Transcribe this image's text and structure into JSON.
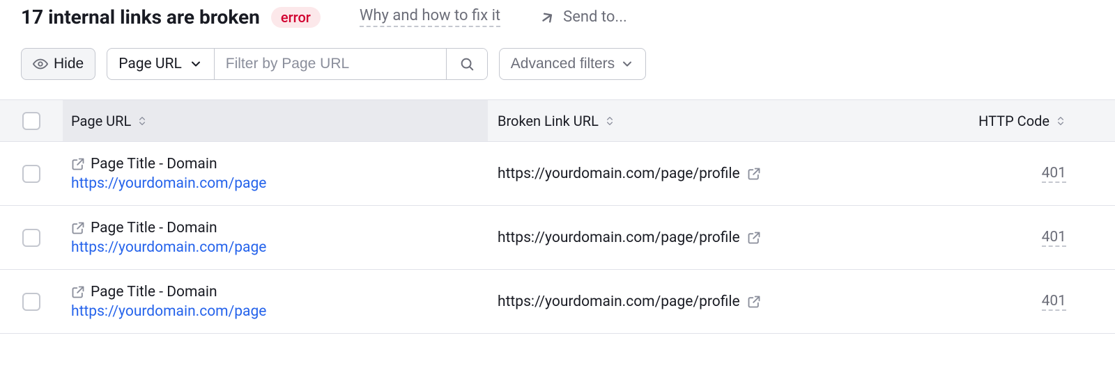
{
  "header": {
    "title": "17 internal links are broken",
    "badge": "error",
    "howfix": "Why and how to fix it",
    "sendto": "Send to..."
  },
  "toolbar": {
    "hide": "Hide",
    "filter_field": "Page URL",
    "filter_placeholder": "Filter by Page URL",
    "advanced": "Advanced filters"
  },
  "table": {
    "columns": {
      "page": "Page URL",
      "broken": "Broken Link URL",
      "code": "HTTP Code"
    },
    "rows": [
      {
        "title": "Page Title - Domain",
        "url": "https://yourdomain.com/page",
        "broken": "https://yourdomain.com/page/profile",
        "code": "401"
      },
      {
        "title": "Page Title - Domain",
        "url": "https://yourdomain.com/page",
        "broken": "https://yourdomain.com/page/profile",
        "code": "401"
      },
      {
        "title": "Page Title - Domain",
        "url": "https://yourdomain.com/page",
        "broken": "https://yourdomain.com/page/profile",
        "code": "401"
      }
    ]
  }
}
